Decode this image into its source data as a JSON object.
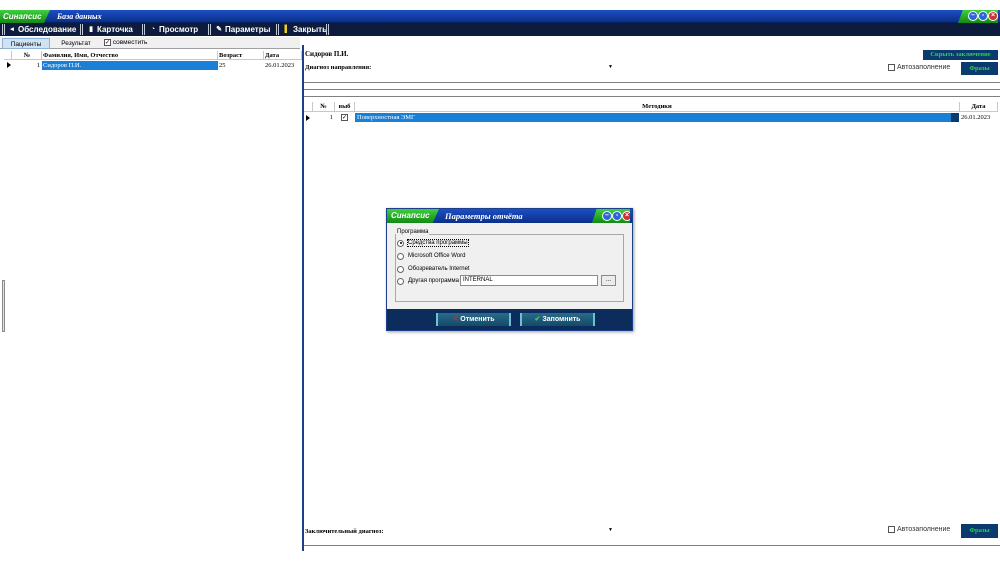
{
  "window": {
    "brand": "Синапсис",
    "title": "База данных"
  },
  "toolbar": {
    "items": [
      {
        "label": "Обследование",
        "icon": "exam-icon"
      },
      {
        "label": "Карточка",
        "icon": "card-icon"
      },
      {
        "label": "Просмотр",
        "icon": "view-icon"
      },
      {
        "label": "Параметры",
        "icon": "settings-icon"
      },
      {
        "label": "Закрыть",
        "icon": "close-door-icon"
      }
    ]
  },
  "tabs": {
    "patients": "Пациенты",
    "result": "Результат",
    "combine": "совместить"
  },
  "patients_table": {
    "headers": [
      "№",
      "Фамилия, Имя, Отчество",
      "Возраст",
      "Дата"
    ],
    "rows": [
      {
        "num": "1",
        "name": "Сидоров П.И.",
        "age": "25",
        "date": "26.01.2023"
      }
    ]
  },
  "right": {
    "patient_name": "Сидоров П.И.",
    "hide_conclusion": "Скрыть заключение",
    "referral_diagnosis": "Диагноз направления:",
    "final_diagnosis": "Заключительный диагноз:",
    "autofill": "Автозаполнение",
    "phrases": "Фразы",
    "methods_headers": [
      "№",
      "выб",
      "Методики",
      "Дата"
    ],
    "methods_rows": [
      {
        "num": "1",
        "checked": "✓",
        "name": "Поверхностная ЭМГ",
        "date": "26.01.2023"
      }
    ]
  },
  "dialog": {
    "brand": "Синапсис",
    "title": "Параметры отчёта",
    "group": "Программа",
    "options": [
      "Средства программы",
      "Microsoft Office Word",
      "Обозреватель Internet",
      "Другая программа"
    ],
    "selected_index": 0,
    "other_value": "INTERNAL",
    "browse": "...",
    "cancel": "Отменить",
    "save": "Запомнить"
  }
}
